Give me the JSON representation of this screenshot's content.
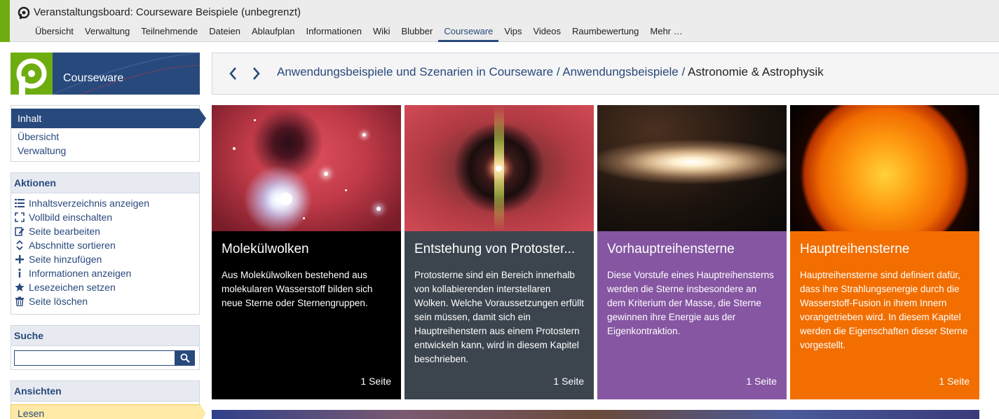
{
  "header": {
    "course_title": "Veranstaltungsboard: Courseware Beispiele (unbegrenzt)",
    "tabs": [
      {
        "label": "Übersicht"
      },
      {
        "label": "Verwaltung"
      },
      {
        "label": "Teilnehmende"
      },
      {
        "label": "Dateien"
      },
      {
        "label": "Ablaufplan"
      },
      {
        "label": "Informationen"
      },
      {
        "label": "Wiki"
      },
      {
        "label": "Blubber"
      },
      {
        "label": "Courseware",
        "active": true
      },
      {
        "label": "Vips"
      },
      {
        "label": "Videos"
      },
      {
        "label": "Raumbewertung"
      },
      {
        "label": "Mehr …"
      }
    ]
  },
  "sidebar": {
    "title": "Courseware",
    "nav": {
      "active": "Inhalt",
      "items": [
        "Übersicht",
        "Verwaltung"
      ]
    },
    "actions": {
      "title": "Aktionen",
      "items": [
        {
          "icon": "toc-icon",
          "label": "Inhaltsverzeichnis anzeigen"
        },
        {
          "icon": "fullscreen-icon",
          "label": "Vollbild einschalten"
        },
        {
          "icon": "edit-icon",
          "label": "Seite bearbeiten"
        },
        {
          "icon": "sort-icon",
          "label": "Abschnitte sortieren"
        },
        {
          "icon": "add-icon",
          "label": "Seite hinzufügen"
        },
        {
          "icon": "info-icon",
          "label": "Informationen anzeigen"
        },
        {
          "icon": "star-icon",
          "label": "Lesezeichen setzen"
        },
        {
          "icon": "trash-icon",
          "label": "Seite löschen"
        }
      ]
    },
    "search": {
      "title": "Suche",
      "value": "",
      "placeholder": ""
    },
    "views": {
      "title": "Ansichten",
      "active": "Lesen"
    }
  },
  "breadcrumb": {
    "items": [
      "Anwendungsbeispiele und Szenarien in Courseware",
      "Anwendungsbeispiele"
    ],
    "separator": "/",
    "current": "Astronomie & Astrophysik"
  },
  "cards": [
    {
      "title": "Molekülwolken",
      "description": "Aus Molekülwolken bestehend aus molekularen Wasserstoff bilden sich neue Sterne oder Sternengruppen.",
      "pages": "1 Seite",
      "color": "#000000"
    },
    {
      "title": "Entstehung von Protoster...",
      "description": "Protosterne sind ein Bereich innerhalb von kollabierenden interstellaren Wolken. Welche Voraussetzungen erfüllt sein müssen, damit sich ein Hauptreihenstern aus einem Protostern entwickeln kann, wird in diesem Kapitel beschrieben.",
      "pages": "1 Seite",
      "color": "#3c454e"
    },
    {
      "title": "Vorhauptreihensterne",
      "description": "Diese Vorstufe eines Hauptreihensterns werden die Sterne insbesondere an dem Kriterium der Masse, die Sterne gewinnen ihre Energie aus der Eigenkontraktion.",
      "pages": "1 Seite",
      "color": "#8656a2"
    },
    {
      "title": "Hauptreihensterne",
      "description": "Hauptreihensterne sind definiert dafür, dass ihre Strahlungsenergie durch die Wasserstoff-Fusion in ihrem Innern vorangetrieben wird. In diesem Kapitel werden die Eigenschaften dieser Sterne vorgestellt.",
      "pages": "1 Seite",
      "color": "#f26e00"
    }
  ],
  "colors": {
    "brand_blue": "#28497c",
    "brand_green": "#6ead10",
    "view_highlight": "#fee9a6"
  }
}
